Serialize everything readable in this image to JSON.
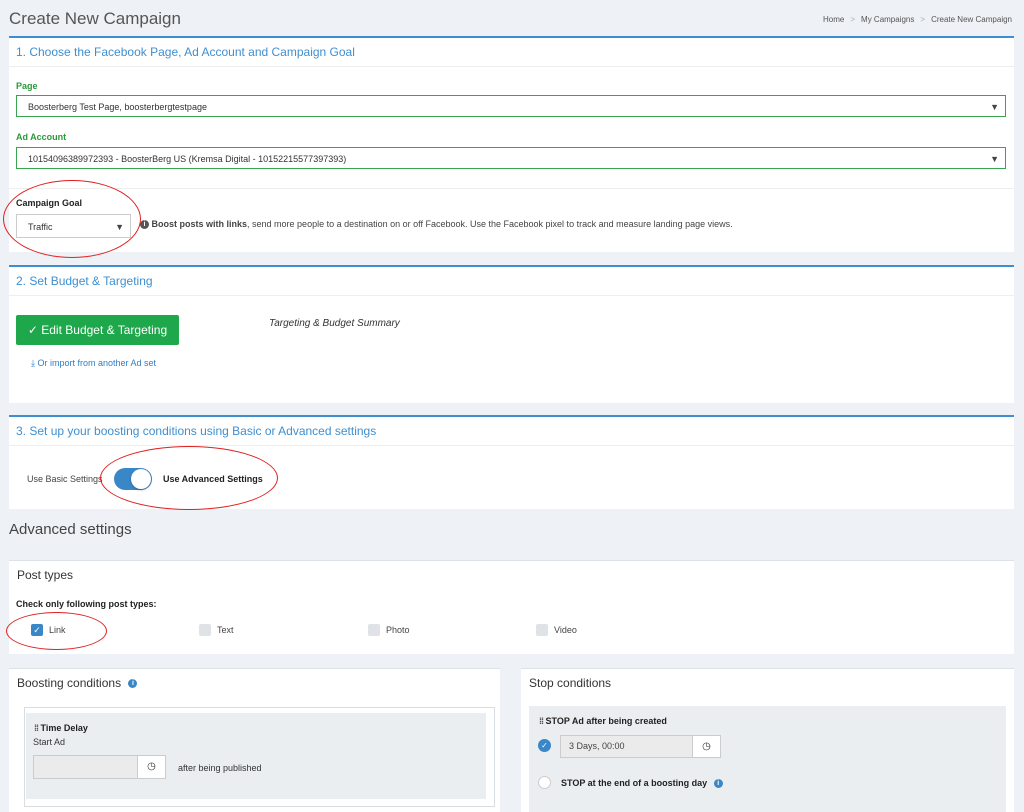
{
  "page": {
    "title": "Create New Campaign"
  },
  "breadcrumb": {
    "home": "Home",
    "campaigns": "My Campaigns",
    "current": "Create New Campaign",
    "sep": ">"
  },
  "section1": {
    "title": "1. Choose the Facebook Page, Ad Account and Campaign Goal",
    "page_label": "Page",
    "page_value": "Boosterberg Test Page, boosterbergtestpage",
    "ad_account_label": "Ad Account",
    "ad_account_value": "10154096389972393 - BoosterBerg US (Kremsa Digital - 10152215577397393)",
    "goal_label": "Campaign Goal",
    "goal_value": "Traffic",
    "goal_desc_bold": "Boost posts with links",
    "goal_desc_rest": ", send more people to a destination on or off Facebook. Use the Facebook pixel to track and measure landing page views."
  },
  "section2": {
    "title": "2. Set Budget & Targeting",
    "edit_button": "✓ Edit Budget & Targeting",
    "import_link": "Or import from another Ad set",
    "summary_title": "Targeting & Budget Summary"
  },
  "section3": {
    "title": "3. Set up your boosting conditions using Basic or Advanced settings",
    "basic_label": "Use Basic Settings",
    "advanced_label": "Use Advanced Settings"
  },
  "advanced": {
    "heading": "Advanced settings",
    "post_types_title": "Post types",
    "post_types_instruction": "Check only following post types:",
    "post_types": [
      {
        "label": "Link",
        "checked": true
      },
      {
        "label": "Text",
        "checked": false
      },
      {
        "label": "Photo",
        "checked": false
      },
      {
        "label": "Video",
        "checked": false
      }
    ]
  },
  "boosting": {
    "title": "Boosting conditions",
    "time_delay_title": "Time Delay",
    "start_ad": "Start Ad",
    "after_published": "after being published"
  },
  "stop": {
    "title": "Stop conditions",
    "stop_after_created": "STOP Ad after being created",
    "duration_value": "3 Days, 00:00",
    "stop_end_day": "STOP at the end of a boosting day"
  },
  "colors": {
    "accent": "#3f8fd0",
    "green": "#1fa84b",
    "annotation": "#e02020"
  },
  "icons": {
    "clock": "clock-icon",
    "info": "info-icon",
    "download": "download-icon",
    "grip": "drag-handle-icon",
    "caret": "caret-down-icon"
  }
}
